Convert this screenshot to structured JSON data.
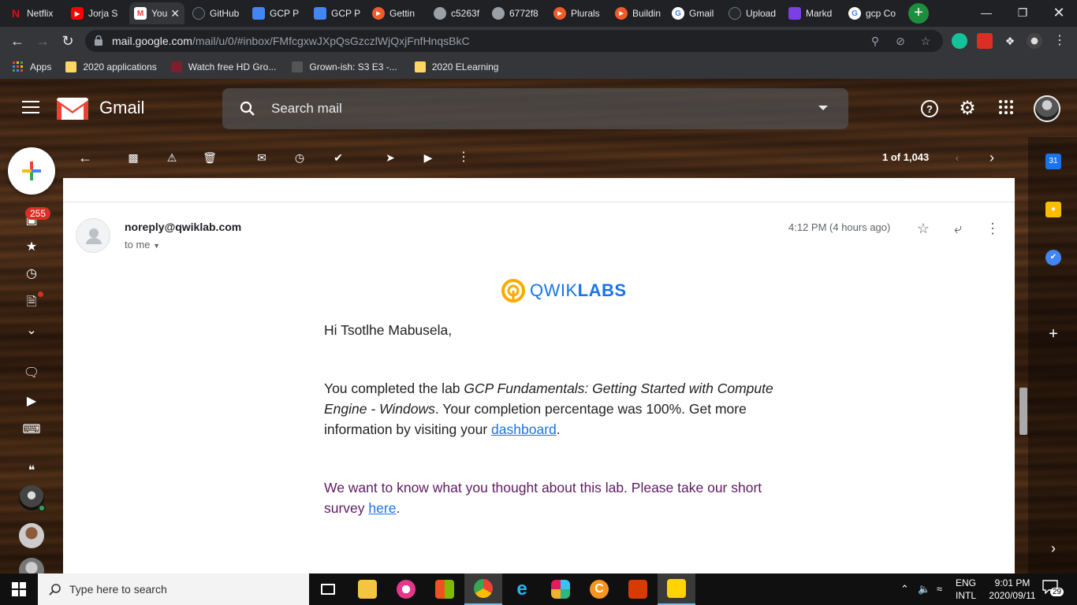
{
  "browser": {
    "tabs": [
      {
        "label": "Netflix",
        "icon": "netflix-icon",
        "color": "#e50914",
        "active": false
      },
      {
        "label": "Jorja S",
        "icon": "youtube-icon",
        "color": "#ff0000",
        "active": false
      },
      {
        "label": "You",
        "icon": "gmail-icon",
        "color": "#ffffff",
        "active": true
      },
      {
        "label": "GitHub",
        "icon": "github-icon",
        "color": "#24292e",
        "active": false
      },
      {
        "label": "GCP P",
        "icon": "google-docs-icon",
        "color": "#4285f4",
        "active": false
      },
      {
        "label": "GCP P",
        "icon": "google-docs-icon",
        "color": "#4285f4",
        "active": false
      },
      {
        "label": "Gettin",
        "icon": "pluralsight-icon",
        "color": "#f15b2a",
        "active": false
      },
      {
        "label": "c5263f",
        "icon": "globe-icon",
        "color": "#9aa0a6",
        "active": false
      },
      {
        "label": "6772f8",
        "icon": "globe-icon",
        "color": "#9aa0a6",
        "active": false
      },
      {
        "label": "Plurals",
        "icon": "pluralsight-icon",
        "color": "#f15b2a",
        "active": false
      },
      {
        "label": "Buildin",
        "icon": "pluralsight-icon",
        "color": "#f15b2a",
        "active": false
      },
      {
        "label": "Gmail",
        "icon": "google-icon",
        "color": "#ffffff",
        "active": false
      },
      {
        "label": "Upload",
        "icon": "github-icon",
        "color": "#24292e",
        "active": false
      },
      {
        "label": "Markd",
        "icon": "markdown-icon",
        "color": "#7b3fe4",
        "active": false
      },
      {
        "label": "gcp Co",
        "icon": "google-icon",
        "color": "#ffffff",
        "active": false
      }
    ],
    "url_host": "mail.google.com",
    "url_path": "/mail/u/0/#inbox/FMfcgxwJXpQsGzczlWjQxjFnfHnqsBkC",
    "bookmarks": [
      {
        "label": "Apps",
        "icon": "apps-grid-icon"
      },
      {
        "label": "2020 applications",
        "icon": "folder-icon"
      },
      {
        "label": "Watch free HD Gro...",
        "icon": "site-icon"
      },
      {
        "label": "Grown-ish: S3 E3 -...",
        "icon": "site-icon"
      },
      {
        "label": "2020 ELearning",
        "icon": "folder-icon"
      }
    ]
  },
  "gmail": {
    "brand": "Gmail",
    "search_placeholder": "Search mail",
    "unread_count": "255",
    "pager": "1 of 1,043",
    "message": {
      "sender": "noreply@qwiklab.com",
      "recipient": "to me",
      "time": "4:12 PM (4 hours ago)",
      "logo_text_light": "QWIK",
      "logo_text_bold": "LABS",
      "greeting": "Hi Tsotlhe Mabusela,",
      "para1_start": "You completed the lab ",
      "para1_lab": "GCP Fundamentals: Getting Started with Compute Engine - Windows",
      "para1_mid": ". Your completion percentage was 100%. Get more information by visiting your ",
      "para1_link": "dashboard",
      "para1_end": ".",
      "para2_start": "We want to know what you thought about this lab. Please take our short survey ",
      "para2_link": "here",
      "para2_end": "."
    },
    "colors": {
      "qwiklabs_yellow": "#f9ab00",
      "qwiklabs_blue": "#1a73e8",
      "link": "#1a73e8",
      "survey_text": "#5e1a63"
    }
  },
  "taskbar": {
    "search_placeholder": "Type here to search",
    "language_line1": "ENG",
    "language_line2": "INTL",
    "time": "9:01 PM",
    "date": "2020/09/11",
    "notification_count": "29"
  }
}
